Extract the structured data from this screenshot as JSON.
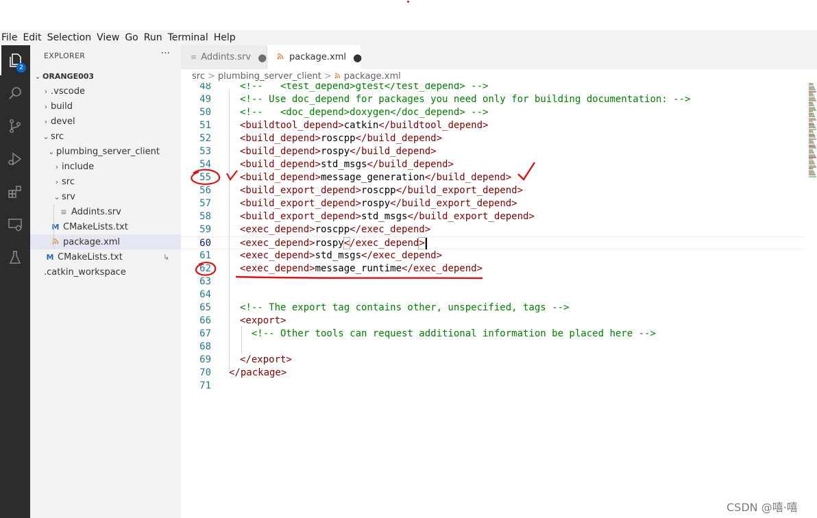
{
  "menu": [
    "File",
    "Edit",
    "Selection",
    "View",
    "Go",
    "Run",
    "Terminal",
    "Help"
  ],
  "activity": {
    "explorer_badge": "2"
  },
  "explorer": {
    "title": "EXPLORER",
    "more": "···",
    "root": "ORANGE003",
    "items": [
      {
        "label": ".vscode",
        "kind": "folder",
        "expanded": false
      },
      {
        "label": "build",
        "kind": "folder",
        "expanded": false
      },
      {
        "label": "devel",
        "kind": "folder",
        "expanded": false
      },
      {
        "label": "src",
        "kind": "folder",
        "expanded": true
      },
      {
        "label": "plumbing_server_client",
        "kind": "folder",
        "expanded": true
      },
      {
        "label": "include",
        "kind": "folder",
        "expanded": false
      },
      {
        "label": "src",
        "kind": "folder",
        "expanded": false
      },
      {
        "label": "srv",
        "kind": "folder",
        "expanded": true
      },
      {
        "label": "Addints.srv",
        "kind": "file",
        "icon": "≡"
      },
      {
        "label": "CMakeLists.txt",
        "kind": "file",
        "icon": "M"
      },
      {
        "label": "package.xml",
        "kind": "file",
        "icon": "rss"
      },
      {
        "label": "CMakeLists.txt",
        "kind": "file",
        "icon": "M",
        "extra": "↳"
      },
      {
        "label": ".catkin_workspace",
        "kind": "file",
        "icon": ""
      }
    ]
  },
  "tabs": [
    {
      "label": "Addints.srv",
      "dirty": "●"
    },
    {
      "label": "package.xml",
      "dirty": "●"
    }
  ],
  "breadcrumb": {
    "part1": "src",
    "part2": "plumbing_server_client",
    "part3": "package.xml",
    "sep": ">"
  },
  "editor": {
    "current_line": 60,
    "lines": [
      {
        "n": "48",
        "code": "<!--   <test_depend>gtest</test_depend> -->"
      },
      {
        "n": "49",
        "code": "<!-- Use doc_depend for packages you need only for building documentation: -->"
      },
      {
        "n": "50",
        "code": "<!--   <doc_depend>doxygen</doc_depend> -->"
      },
      {
        "n": "51",
        "code": "<buildtool_depend>catkin</buildtool_depend>"
      },
      {
        "n": "52",
        "code": "<build_depend>roscpp</build_depend>"
      },
      {
        "n": "53",
        "code": "<build_depend>rospy</build_depend>"
      },
      {
        "n": "54",
        "code": "<build_depend>std_msgs</build_depend>"
      },
      {
        "n": "55",
        "code": "<build_depend>message_generation</build_depend>"
      },
      {
        "n": "56",
        "code": "<build_export_depend>roscpp</build_export_depend>"
      },
      {
        "n": "57",
        "code": "<build_export_depend>rospy</build_export_depend>"
      },
      {
        "n": "58",
        "code": "<build_export_depend>std_msgs</build_export_depend>"
      },
      {
        "n": "59",
        "code": "<exec_depend>roscpp</exec_depend>"
      },
      {
        "n": "60",
        "code": "<exec_depend>rospy</exec_depend>"
      },
      {
        "n": "61",
        "code": "<exec_depend>std_msgs</exec_depend>"
      },
      {
        "n": "62",
        "code": "<exec_depend>message_runtime</exec_depend>"
      },
      {
        "n": "63",
        "code": ""
      },
      {
        "n": "64",
        "code": ""
      },
      {
        "n": "65",
        "code": "<!-- The export tag contains other, unspecified, tags -->"
      },
      {
        "n": "66",
        "code": "<export>"
      },
      {
        "n": "67",
        "code": "  <!-- Other tools can request additional information be placed here -->"
      },
      {
        "n": "68",
        "code": ""
      },
      {
        "n": "69",
        "code": "</export>"
      },
      {
        "n": "70",
        "code": "</package>"
      },
      {
        "n": "71",
        "code": ""
      }
    ]
  },
  "watermark": "CSDN @嘻·嘻",
  "colors": {
    "tag": "#800000",
    "comment": "#008000",
    "line_number": "#237893",
    "annotation": "#dd1111"
  }
}
